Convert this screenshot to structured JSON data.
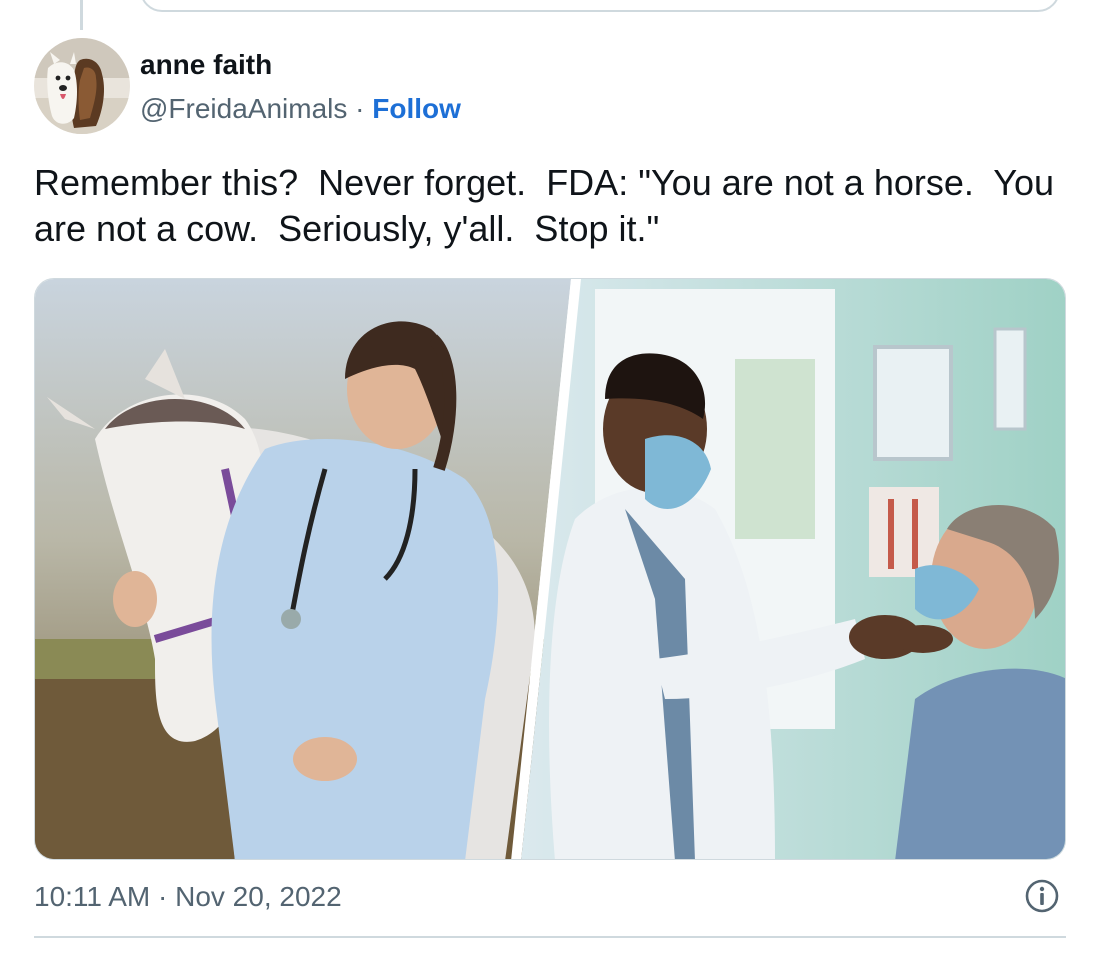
{
  "tweet": {
    "author": {
      "display_name": "anne faith",
      "handle": "@FreidaAnimals",
      "separator": " · ",
      "follow_label": "Follow",
      "avatar_icon": "dog-avatar"
    },
    "text": "Remember this?  Never forget.  FDA: \"You are not a horse.  You are not a cow.  Seriously, y'all.  Stop it.\"",
    "media": {
      "panels": [
        "veterinarian-with-horse",
        "doctor-with-masked-patient"
      ]
    },
    "timestamp": "10:11 AM · Nov 20, 2022",
    "info_icon": "info-icon"
  },
  "colors": {
    "link": "#1d6fd6",
    "text": "#0f1419",
    "secondary": "#536471",
    "border": "#cfd9de"
  }
}
